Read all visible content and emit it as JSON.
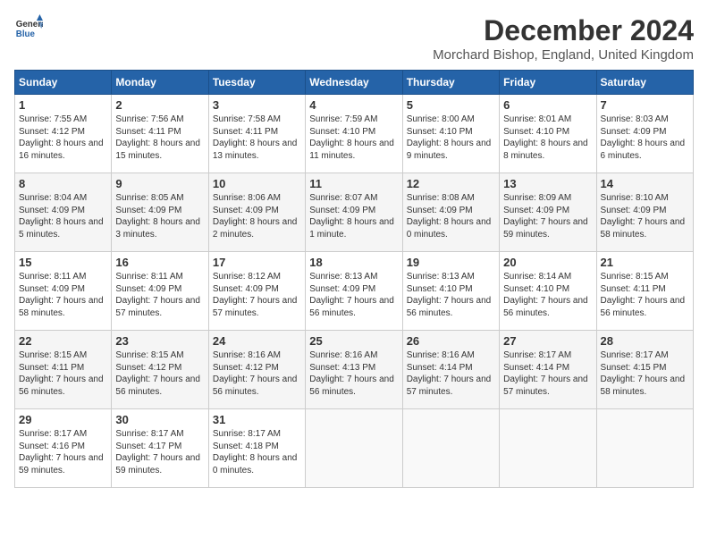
{
  "header": {
    "logo_line1": "General",
    "logo_line2": "Blue",
    "month": "December 2024",
    "location": "Morchard Bishop, England, United Kingdom"
  },
  "weekdays": [
    "Sunday",
    "Monday",
    "Tuesday",
    "Wednesday",
    "Thursday",
    "Friday",
    "Saturday"
  ],
  "weeks": [
    [
      {
        "day": "1",
        "sunrise": "7:55 AM",
        "sunset": "4:12 PM",
        "daylight": "8 hours and 16 minutes."
      },
      {
        "day": "2",
        "sunrise": "7:56 AM",
        "sunset": "4:11 PM",
        "daylight": "8 hours and 15 minutes."
      },
      {
        "day": "3",
        "sunrise": "7:58 AM",
        "sunset": "4:11 PM",
        "daylight": "8 hours and 13 minutes."
      },
      {
        "day": "4",
        "sunrise": "7:59 AM",
        "sunset": "4:10 PM",
        "daylight": "8 hours and 11 minutes."
      },
      {
        "day": "5",
        "sunrise": "8:00 AM",
        "sunset": "4:10 PM",
        "daylight": "8 hours and 9 minutes."
      },
      {
        "day": "6",
        "sunrise": "8:01 AM",
        "sunset": "4:10 PM",
        "daylight": "8 hours and 8 minutes."
      },
      {
        "day": "7",
        "sunrise": "8:03 AM",
        "sunset": "4:09 PM",
        "daylight": "8 hours and 6 minutes."
      }
    ],
    [
      {
        "day": "8",
        "sunrise": "8:04 AM",
        "sunset": "4:09 PM",
        "daylight": "8 hours and 5 minutes."
      },
      {
        "day": "9",
        "sunrise": "8:05 AM",
        "sunset": "4:09 PM",
        "daylight": "8 hours and 3 minutes."
      },
      {
        "day": "10",
        "sunrise": "8:06 AM",
        "sunset": "4:09 PM",
        "daylight": "8 hours and 2 minutes."
      },
      {
        "day": "11",
        "sunrise": "8:07 AM",
        "sunset": "4:09 PM",
        "daylight": "8 hours and 1 minute."
      },
      {
        "day": "12",
        "sunrise": "8:08 AM",
        "sunset": "4:09 PM",
        "daylight": "8 hours and 0 minutes."
      },
      {
        "day": "13",
        "sunrise": "8:09 AM",
        "sunset": "4:09 PM",
        "daylight": "7 hours and 59 minutes."
      },
      {
        "day": "14",
        "sunrise": "8:10 AM",
        "sunset": "4:09 PM",
        "daylight": "7 hours and 58 minutes."
      }
    ],
    [
      {
        "day": "15",
        "sunrise": "8:11 AM",
        "sunset": "4:09 PM",
        "daylight": "7 hours and 58 minutes."
      },
      {
        "day": "16",
        "sunrise": "8:11 AM",
        "sunset": "4:09 PM",
        "daylight": "7 hours and 57 minutes."
      },
      {
        "day": "17",
        "sunrise": "8:12 AM",
        "sunset": "4:09 PM",
        "daylight": "7 hours and 57 minutes."
      },
      {
        "day": "18",
        "sunrise": "8:13 AM",
        "sunset": "4:09 PM",
        "daylight": "7 hours and 56 minutes."
      },
      {
        "day": "19",
        "sunrise": "8:13 AM",
        "sunset": "4:10 PM",
        "daylight": "7 hours and 56 minutes."
      },
      {
        "day": "20",
        "sunrise": "8:14 AM",
        "sunset": "4:10 PM",
        "daylight": "7 hours and 56 minutes."
      },
      {
        "day": "21",
        "sunrise": "8:15 AM",
        "sunset": "4:11 PM",
        "daylight": "7 hours and 56 minutes."
      }
    ],
    [
      {
        "day": "22",
        "sunrise": "8:15 AM",
        "sunset": "4:11 PM",
        "daylight": "7 hours and 56 minutes."
      },
      {
        "day": "23",
        "sunrise": "8:15 AM",
        "sunset": "4:12 PM",
        "daylight": "7 hours and 56 minutes."
      },
      {
        "day": "24",
        "sunrise": "8:16 AM",
        "sunset": "4:12 PM",
        "daylight": "7 hours and 56 minutes."
      },
      {
        "day": "25",
        "sunrise": "8:16 AM",
        "sunset": "4:13 PM",
        "daylight": "7 hours and 56 minutes."
      },
      {
        "day": "26",
        "sunrise": "8:16 AM",
        "sunset": "4:14 PM",
        "daylight": "7 hours and 57 minutes."
      },
      {
        "day": "27",
        "sunrise": "8:17 AM",
        "sunset": "4:14 PM",
        "daylight": "7 hours and 57 minutes."
      },
      {
        "day": "28",
        "sunrise": "8:17 AM",
        "sunset": "4:15 PM",
        "daylight": "7 hours and 58 minutes."
      }
    ],
    [
      {
        "day": "29",
        "sunrise": "8:17 AM",
        "sunset": "4:16 PM",
        "daylight": "7 hours and 59 minutes."
      },
      {
        "day": "30",
        "sunrise": "8:17 AM",
        "sunset": "4:17 PM",
        "daylight": "7 hours and 59 minutes."
      },
      {
        "day": "31",
        "sunrise": "8:17 AM",
        "sunset": "4:18 PM",
        "daylight": "8 hours and 0 minutes."
      },
      null,
      null,
      null,
      null
    ]
  ]
}
